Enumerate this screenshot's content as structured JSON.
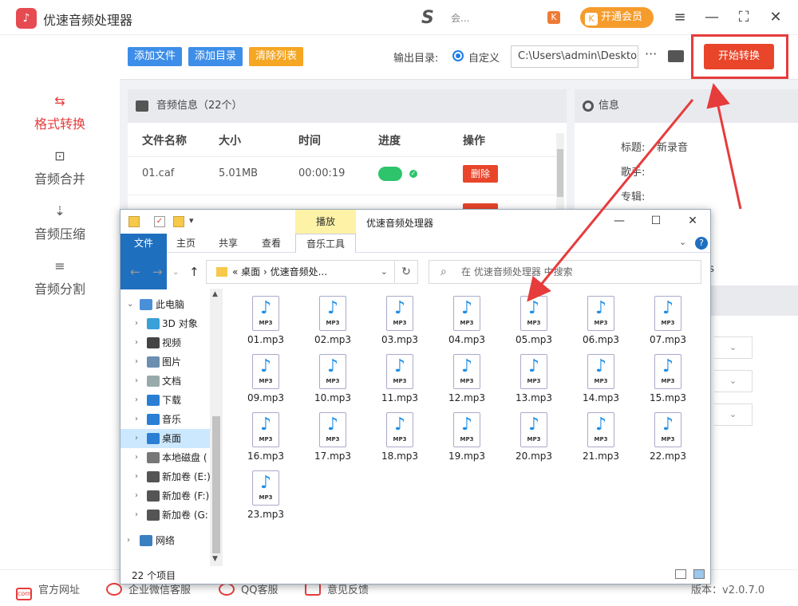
{
  "app": {
    "title": "优速音频处理器",
    "user_name": "会...",
    "vip_label": "开通会员"
  },
  "sidebar": {
    "items": [
      {
        "label": "格式转换"
      },
      {
        "label": "音频合并"
      },
      {
        "label": "音频压缩"
      },
      {
        "label": "音频分割"
      }
    ]
  },
  "toolbar": {
    "add_file": "添加文件",
    "add_dir": "添加目录",
    "clear_list": "清除列表",
    "output_label": "输出目录:",
    "custom_label": "自定义",
    "path": "C:\\Users\\admin\\Desktop",
    "more": "···",
    "start": "开始转换"
  },
  "audio_panel": {
    "header": "音频信息（22个）",
    "columns": [
      "文件名称",
      "大小",
      "时间",
      "进度",
      "操作"
    ],
    "rows": [
      {
        "name": "01.caf",
        "size": "5.01MB",
        "time": "00:00:19",
        "action": "删除"
      }
    ]
  },
  "info_panel": {
    "header": "信息",
    "title_label": "标题:",
    "title_value": "新录音",
    "singer_label": "歌手:",
    "album_label": "专辑:",
    "bitrate_fragment": "ps"
  },
  "explorer": {
    "play_tab": "播放",
    "title": "优速音频处理器",
    "ribbon": [
      "文件",
      "主页",
      "共享",
      "查看",
      "音乐工具"
    ],
    "address": "« 桌面 › 优速音频处...",
    "search_placeholder": "在 优速音频处理器 中搜索",
    "nav": [
      {
        "label": "此电脑",
        "color": "#4a90d9"
      },
      {
        "label": "3D 对象",
        "color": "#3aa0d8"
      },
      {
        "label": "视频",
        "color": "#444"
      },
      {
        "label": "图片",
        "color": "#6c8fb0"
      },
      {
        "label": "文档",
        "color": "#9aa"
      },
      {
        "label": "下载",
        "color": "#2a7fd4"
      },
      {
        "label": "音乐",
        "color": "#2a7fd4"
      },
      {
        "label": "桌面",
        "color": "#2a7fd4"
      },
      {
        "label": "本地磁盘 (",
        "color": "#777"
      },
      {
        "label": "新加卷 (E:)",
        "color": "#555"
      },
      {
        "label": "新加卷 (F:)",
        "color": "#555"
      },
      {
        "label": "新加卷 (G:",
        "color": "#555"
      },
      {
        "label": "网络",
        "color": "#3a7fc0"
      }
    ],
    "files": [
      "01.mp3",
      "02.mp3",
      "03.mp3",
      "04.mp3",
      "05.mp3",
      "06.mp3",
      "07.mp3",
      "09.mp3",
      "10.mp3",
      "11.mp3",
      "12.mp3",
      "13.mp3",
      "14.mp3",
      "15.mp3",
      "16.mp3",
      "17.mp3",
      "18.mp3",
      "19.mp3",
      "20.mp3",
      "21.mp3",
      "22.mp3",
      "23.mp3"
    ],
    "file_badge": "MP3",
    "status": "22 个项目"
  },
  "footer": {
    "links": [
      "官方网址",
      "企业微信客服",
      "QQ客服",
      "意见反馈"
    ],
    "version": "版本：v2.0.7.0"
  },
  "colors": {
    "accent_red": "#e8452a",
    "blue": "#3d8ee8",
    "orange": "#f5a623",
    "progress_green": "#2dc46b"
  }
}
